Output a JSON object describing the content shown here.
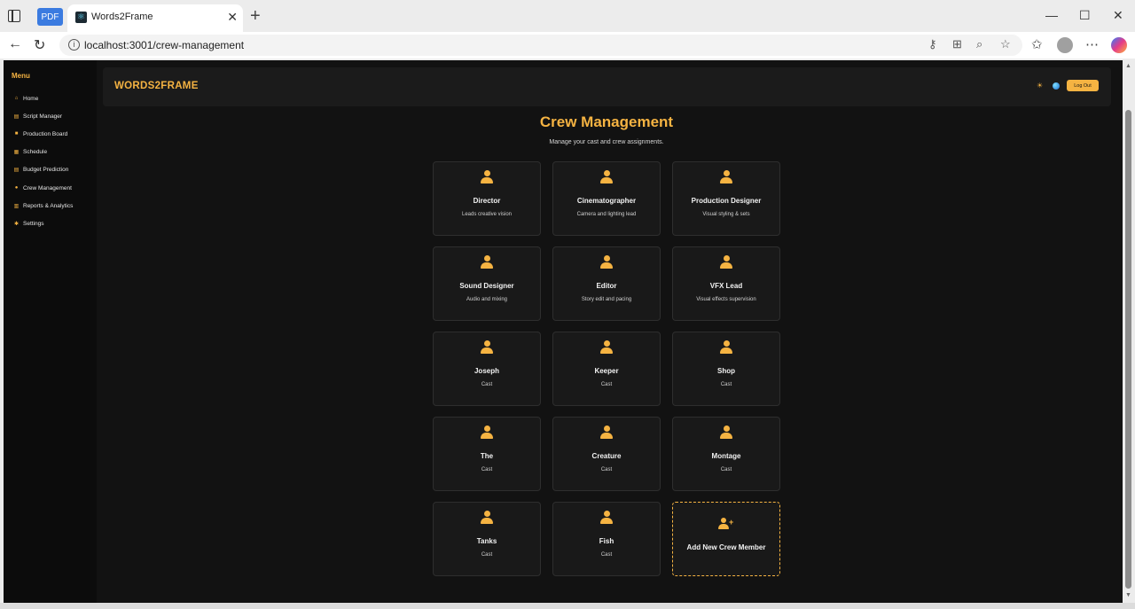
{
  "browser": {
    "pdf_tab": "PDF",
    "tab_title": "Words2Frame",
    "url": "localhost:3001/crew-management"
  },
  "sidebar": {
    "menu_title": "Menu",
    "items": [
      {
        "label": "Home",
        "icon": "home-icon"
      },
      {
        "label": "Script Manager",
        "icon": "document-icon"
      },
      {
        "label": "Production Board",
        "icon": "video-icon"
      },
      {
        "label": "Schedule",
        "icon": "calendar-icon"
      },
      {
        "label": "Budget Prediction",
        "icon": "document-icon"
      },
      {
        "label": "Crew Management",
        "icon": "users-icon"
      },
      {
        "label": "Reports & Analytics",
        "icon": "chart-icon"
      },
      {
        "label": "Settings",
        "icon": "gear-icon"
      }
    ]
  },
  "header": {
    "brand": "WORDS2FRAME",
    "logout_label": "Log Out"
  },
  "main": {
    "title": "Crew Management",
    "subtitle": "Manage your cast and crew assignments.",
    "cards": [
      {
        "name": "Director",
        "desc": "Leads creative vision"
      },
      {
        "name": "Cinematographer",
        "desc": "Camera and lighting lead"
      },
      {
        "name": "Production Designer",
        "desc": "Visual styling & sets"
      },
      {
        "name": "Sound Designer",
        "desc": "Audio and mixing"
      },
      {
        "name": "Editor",
        "desc": "Story edit and pacing"
      },
      {
        "name": "VFX Lead",
        "desc": "Visual effects supervision"
      },
      {
        "name": "Joseph",
        "desc": "Cast"
      },
      {
        "name": "Keeper",
        "desc": "Cast"
      },
      {
        "name": "Shop",
        "desc": "Cast"
      },
      {
        "name": "The",
        "desc": "Cast"
      },
      {
        "name": "Creature",
        "desc": "Cast"
      },
      {
        "name": "Montage",
        "desc": "Cast"
      },
      {
        "name": "Tanks",
        "desc": "Cast"
      },
      {
        "name": "Fish",
        "desc": "Cast"
      }
    ],
    "add_label": "Add New Crew Member"
  },
  "colors": {
    "accent": "#f5b342",
    "background": "#121212",
    "card": "#191919"
  }
}
